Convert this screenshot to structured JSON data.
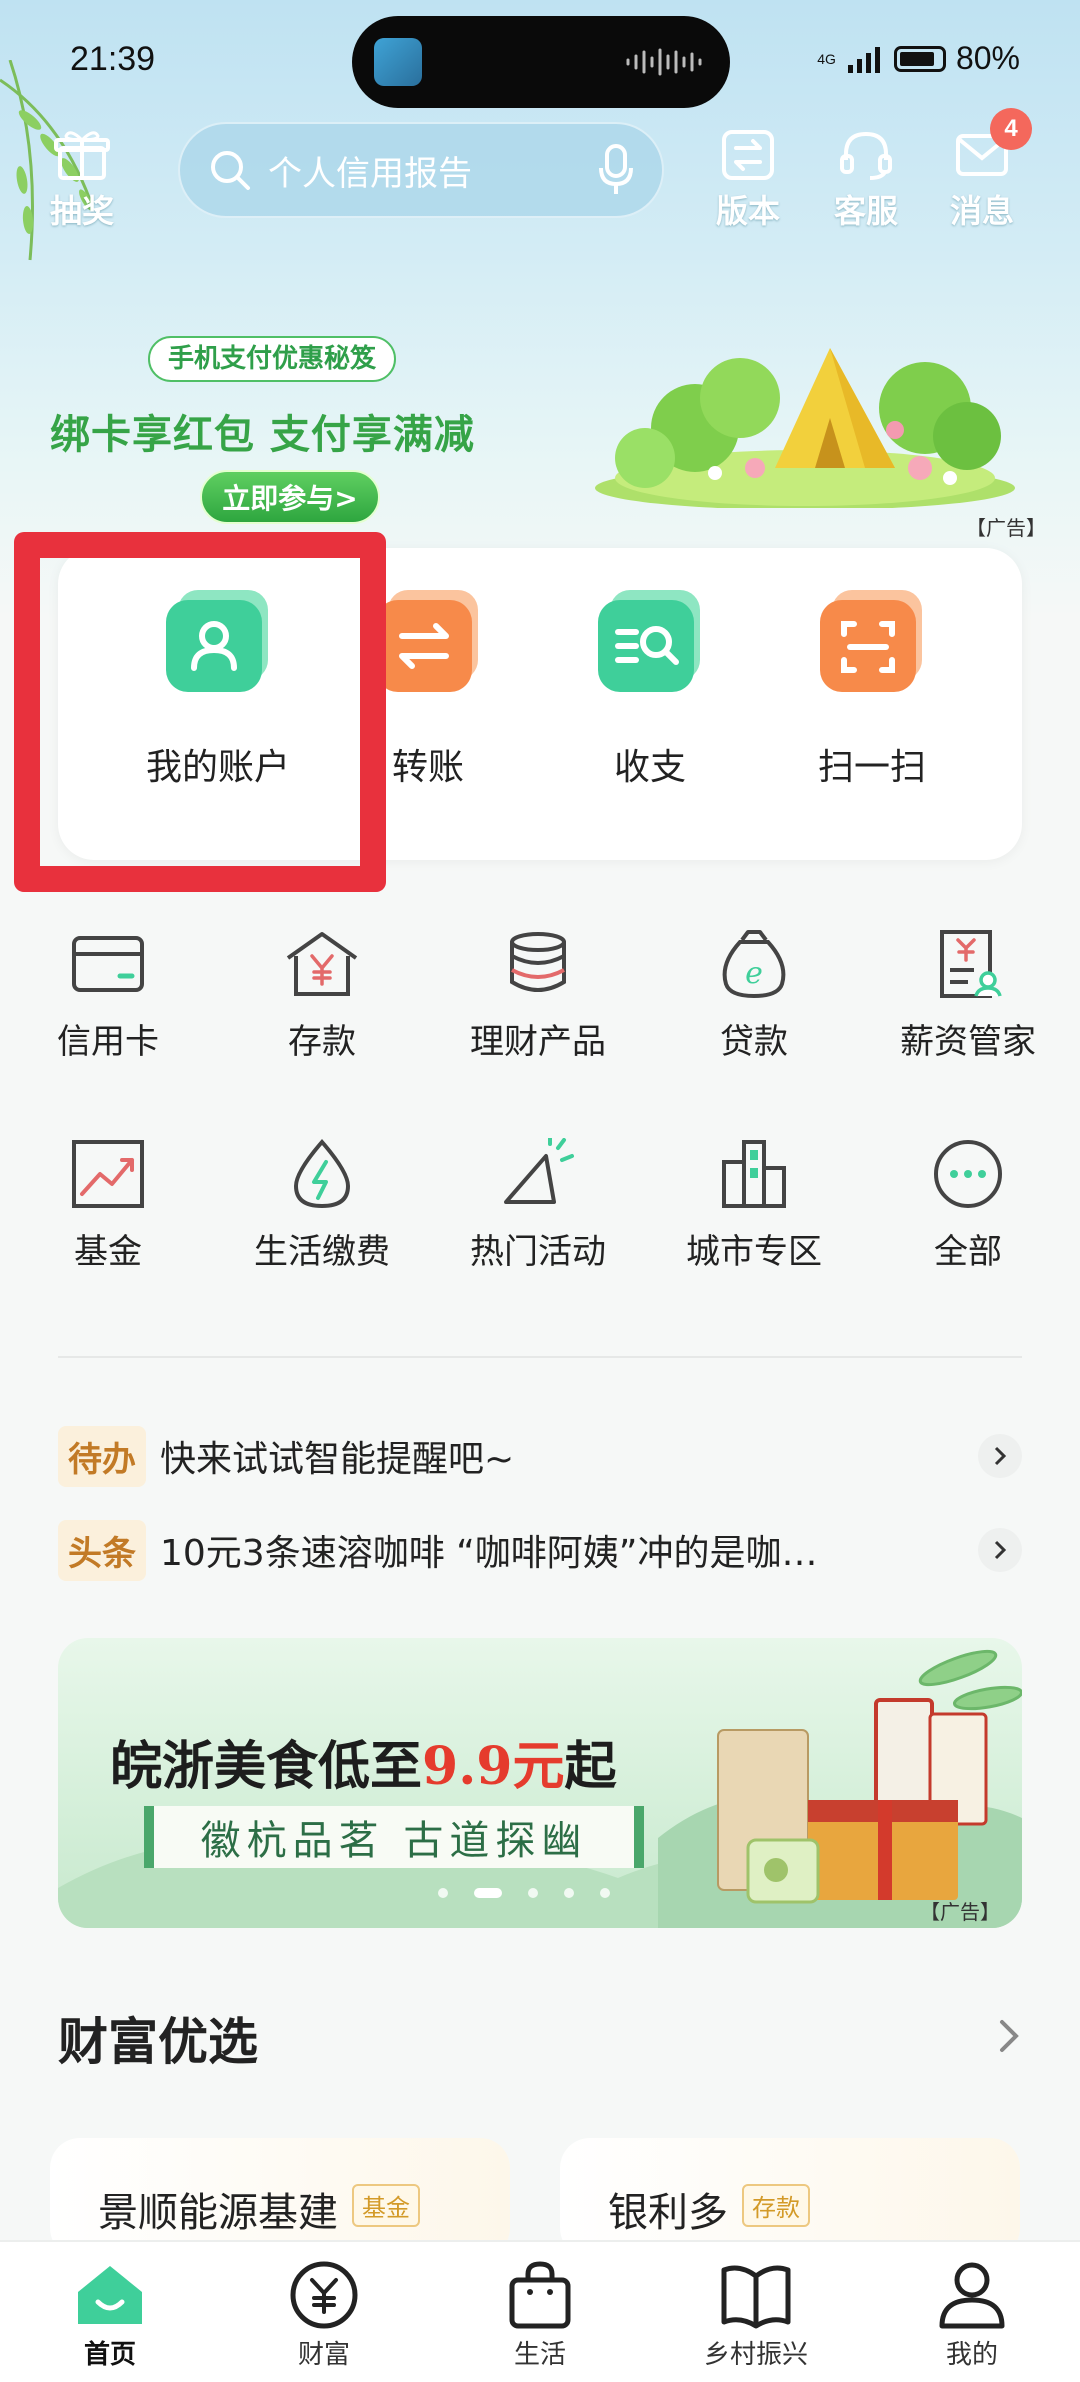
{
  "status_bar": {
    "time": "21:39",
    "network": "4G",
    "battery": "80%"
  },
  "header": {
    "lottery_label": "抽奖",
    "search_placeholder": "个人信用报告",
    "version_label": "版本",
    "service_label": "客服",
    "message_label": "消息",
    "message_badge": "4"
  },
  "promo": {
    "pill": "手机支付优惠秘笈",
    "title": "绑卡享红包 支付享满减",
    "button": "立即参与>",
    "ad_label": "【广告】"
  },
  "quick_actions": [
    {
      "label": "我的账户",
      "icon": "account-icon",
      "color": "#3fcf9a"
    },
    {
      "label": "转账",
      "icon": "transfer-icon",
      "color": "#f78a4a"
    },
    {
      "label": "收支",
      "icon": "income-expense-icon",
      "color": "#3fcf9a"
    },
    {
      "label": "扫一扫",
      "icon": "scan-icon",
      "color": "#f78a4a"
    }
  ],
  "menu_grid": [
    {
      "label": "信用卡",
      "icon": "credit-card-icon"
    },
    {
      "label": "存款",
      "icon": "deposit-icon"
    },
    {
      "label": "理财产品",
      "icon": "wealth-product-icon"
    },
    {
      "label": "贷款",
      "icon": "loan-icon"
    },
    {
      "label": "薪资管家",
      "icon": "salary-icon"
    },
    {
      "label": "基金",
      "icon": "fund-icon"
    },
    {
      "label": "生活缴费",
      "icon": "utility-payment-icon"
    },
    {
      "label": "热门活动",
      "icon": "hot-activity-icon"
    },
    {
      "label": "城市专区",
      "icon": "city-zone-icon"
    },
    {
      "label": "全部",
      "icon": "more-icon"
    }
  ],
  "news": [
    {
      "tag": "待办",
      "text": "快来试试智能提醒吧~"
    },
    {
      "tag": "头条",
      "text": "10元3条速溶咖啡 “咖啡阿姨”冲的是咖…"
    }
  ],
  "banner2": {
    "title_prefix": "皖浙美食低至",
    "title_price": "9.9元",
    "title_suffix": "起",
    "subtitle": "徽杭品茗 古道探幽",
    "ad_label": "【广告】"
  },
  "wealth": {
    "title": "财富优选",
    "products": [
      {
        "name": "景顺能源基建",
        "tag": "基金"
      },
      {
        "name": "银利多",
        "tag": "存款"
      }
    ]
  },
  "bottom_nav": [
    {
      "label": "首页",
      "icon": "home-icon",
      "active": true
    },
    {
      "label": "财富",
      "icon": "wealth-icon"
    },
    {
      "label": "生活",
      "icon": "life-bag-icon"
    },
    {
      "label": "乡村振兴",
      "icon": "rural-revitalization-icon"
    },
    {
      "label": "我的",
      "icon": "profile-icon"
    }
  ],
  "colors": {
    "brand_green": "#3fcf9a",
    "accent_orange": "#f78a4a",
    "highlight_red": "#e8313d"
  }
}
